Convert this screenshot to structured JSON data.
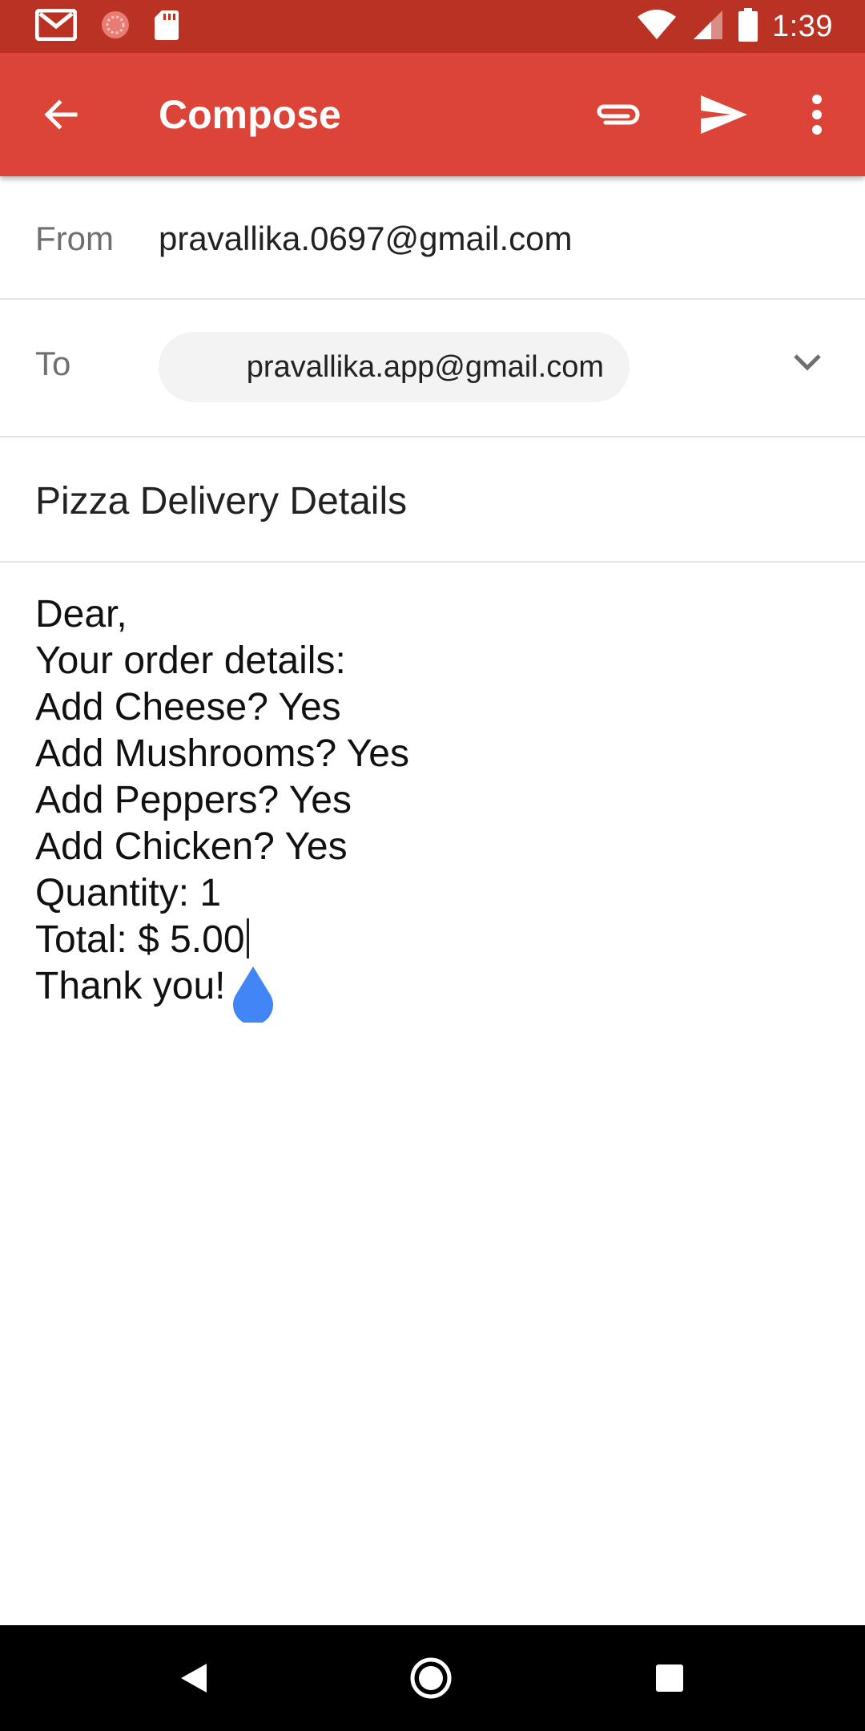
{
  "status_bar": {
    "time": "1:39",
    "icons": [
      "gmail-icon",
      "sync-icon",
      "sd-card-icon",
      "wifi-icon",
      "signal-icon",
      "battery-icon"
    ]
  },
  "app_bar": {
    "title": "Compose",
    "actions": [
      "attach-icon",
      "send-icon",
      "more-vert-icon"
    ],
    "color": "#db4437"
  },
  "compose": {
    "from_label": "From",
    "from_value": "pravallika.0697@gmail.com",
    "to_label": "To",
    "to_chip": "pravallika.app@gmail.com",
    "subject": "Pizza Delivery Details",
    "body_lines": [
      "Dear,",
      "Your order details:",
      "Add Cheese? Yes",
      "Add Mushrooms? Yes",
      "Add Peppers? Yes",
      "Add Chicken? Yes",
      "Quantity: 1",
      "Total: $ 5.00",
      "Thank you!"
    ]
  },
  "nav_bar": {
    "buttons": [
      "back-icon",
      "home-icon",
      "recents-icon"
    ]
  }
}
